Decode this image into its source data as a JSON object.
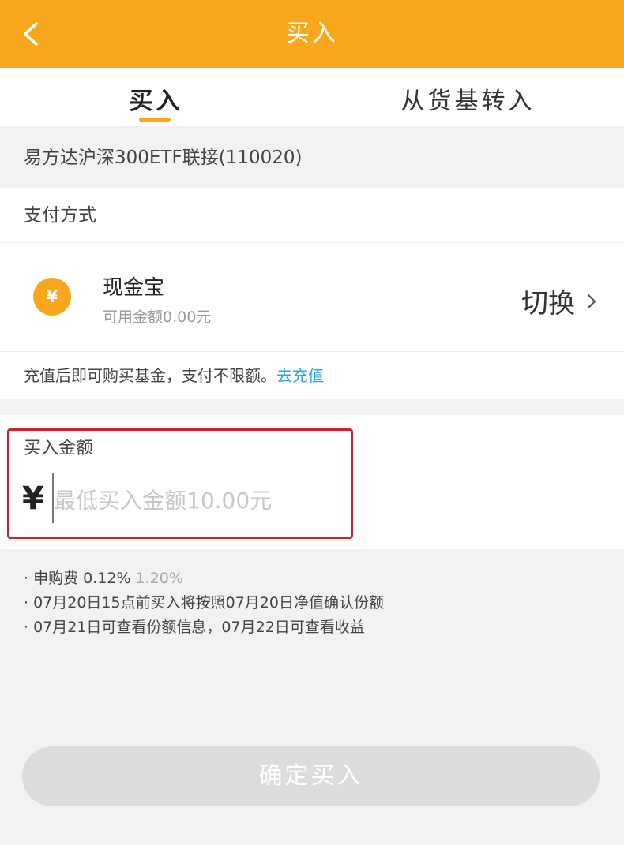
{
  "header": {
    "title": "买入",
    "back_icon": "chevron-left-icon",
    "background": "#f8a71c"
  },
  "tabs": [
    {
      "label": "买入",
      "active": true
    },
    {
      "label": "从货基转入",
      "active": false
    }
  ],
  "fund": {
    "name": "易方达沪深300ETF联接(110020)"
  },
  "payment": {
    "title": "支付方式",
    "method": {
      "icon": "yuan-coin-icon",
      "icon_glyph": "¥",
      "name": "现金宝",
      "balance": "可用金额0.00元"
    },
    "switch_label": "切换",
    "note": "充值后即可购买基金，支付不限额。",
    "recharge_link": "去充值",
    "link_color": "#2aa3e6"
  },
  "amount": {
    "label": "买入金额",
    "currency": "¥",
    "value": "",
    "placeholder": "最低买入金额10.00元",
    "highlight_color": "#d0202a"
  },
  "info": {
    "fee_label": "· 申购费",
    "fee_rate": "0.12%",
    "fee_original": "1.20%",
    "line2": "· 07月20日15点前买入将按照07月20日净值确认份额",
    "line3": "· 07月21日可查看份额信息，07月22日可查看收益"
  },
  "confirm": {
    "label": "确定买入",
    "enabled": false
  }
}
